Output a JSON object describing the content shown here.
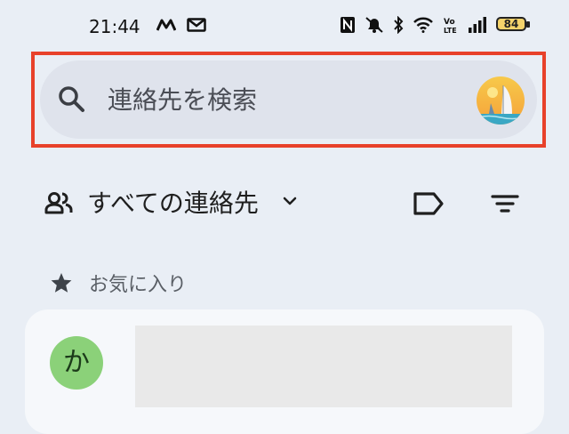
{
  "status_bar": {
    "time": "21:44",
    "battery_level": "84"
  },
  "search": {
    "placeholder": "連絡先を検索"
  },
  "filter": {
    "label": "すべての連絡先"
  },
  "favorites": {
    "header": "お気に入り",
    "contacts": [
      {
        "initial": "か"
      }
    ]
  },
  "colors": {
    "highlight": "#e8412a",
    "avatar_green": "#8bd179",
    "background": "#e9eef5"
  },
  "icons": {
    "status_left": [
      "notification-icon",
      "gmail-icon"
    ],
    "status_right": [
      "nfc-icon",
      "mute-icon",
      "bluetooth-icon",
      "wifi-icon",
      "volte-icon",
      "signal-icon",
      "battery-icon"
    ]
  }
}
